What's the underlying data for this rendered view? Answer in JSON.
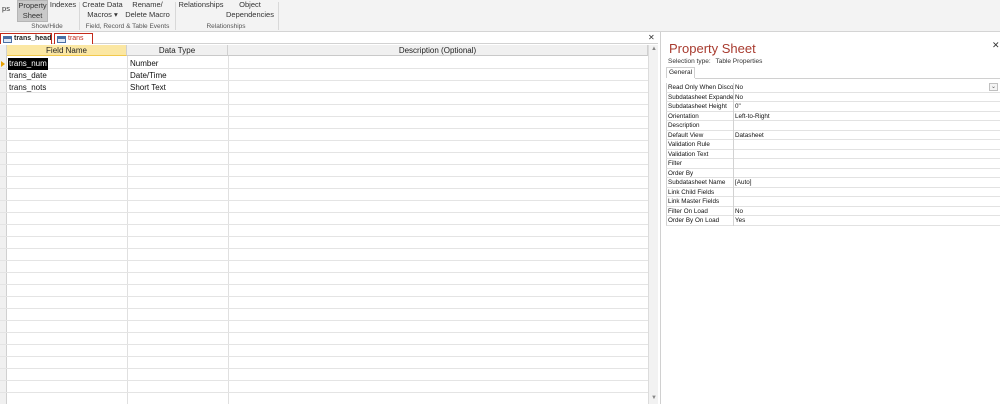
{
  "ribbon": {
    "cut_text": "ps",
    "property_sheet": [
      "Property",
      "Sheet"
    ],
    "indexes": "Indexes",
    "create_data_macros": [
      "Create Data",
      "Macros ▾"
    ],
    "rename_delete_macro": [
      "Rename/",
      "Delete Macro"
    ],
    "relationships": "Relationships",
    "object_dependencies": [
      "Object",
      "Dependencies"
    ],
    "groups": {
      "show_hide": "Show/Hide",
      "field_record_table_events": "Field, Record & Table Events",
      "relationships": "Relationships"
    }
  },
  "tabs": [
    {
      "label": "trans_head",
      "active": true
    },
    {
      "label": "trans",
      "active": false
    }
  ],
  "grid": {
    "headers": [
      "Field Name",
      "Data Type",
      "Description (Optional)"
    ],
    "rows": [
      {
        "field_name": "trans_num",
        "data_type": "Number",
        "description": ""
      },
      {
        "field_name": "trans_date",
        "data_type": "Date/Time",
        "description": ""
      },
      {
        "field_name": "trans_nots",
        "data_type": "Short Text",
        "description": ""
      }
    ]
  },
  "property_sheet": {
    "title": "Property Sheet",
    "selection_type_label": "Selection type:",
    "selection_type_value": "Table Properties",
    "tab_general": "General",
    "properties": [
      {
        "name": "Read Only When Disconnected",
        "value": "No",
        "dropdown": true
      },
      {
        "name": "Subdatasheet Expanded",
        "value": "No"
      },
      {
        "name": "Subdatasheet Height",
        "value": "0\""
      },
      {
        "name": "Orientation",
        "value": "Left-to-Right"
      },
      {
        "name": "Description",
        "value": ""
      },
      {
        "name": "Default View",
        "value": "Datasheet"
      },
      {
        "name": "Validation Rule",
        "value": ""
      },
      {
        "name": "Validation Text",
        "value": ""
      },
      {
        "name": "Filter",
        "value": ""
      },
      {
        "name": "Order By",
        "value": ""
      },
      {
        "name": "Subdatasheet Name",
        "value": "[Auto]"
      },
      {
        "name": "Link Child Fields",
        "value": ""
      },
      {
        "name": "Link Master Fields",
        "value": ""
      },
      {
        "name": "Filter On Load",
        "value": "No"
      },
      {
        "name": "Order By On Load",
        "value": "Yes"
      }
    ]
  },
  "icons": {
    "close": "✕",
    "dropdown": "⌄",
    "scroll_up": "▲",
    "scroll_down": "▼"
  }
}
